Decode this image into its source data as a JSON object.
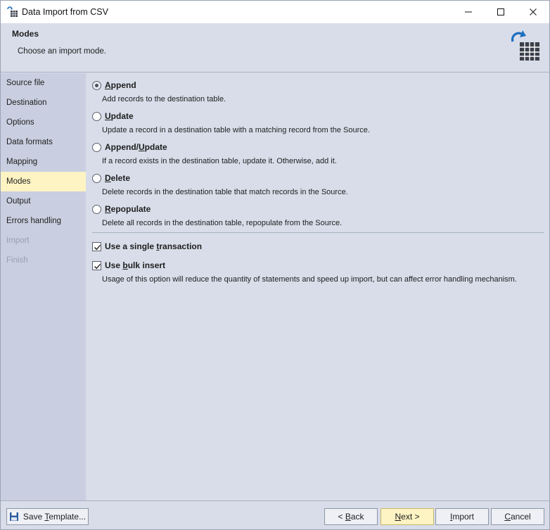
{
  "window": {
    "title": "Data Import from CSV",
    "minimize_icon": "minimize-icon",
    "maximize_icon": "maximize-icon",
    "close_icon": "close-icon"
  },
  "header": {
    "title": "Modes",
    "subtitle": "Choose an import mode."
  },
  "sidebar": {
    "items": [
      {
        "label": "Source file",
        "state": "normal"
      },
      {
        "label": "Destination",
        "state": "normal"
      },
      {
        "label": "Options",
        "state": "normal"
      },
      {
        "label": "Data formats",
        "state": "normal"
      },
      {
        "label": "Mapping",
        "state": "normal"
      },
      {
        "label": "Modes",
        "state": "active"
      },
      {
        "label": "Output",
        "state": "normal"
      },
      {
        "label": "Errors handling",
        "state": "normal"
      },
      {
        "label": "Import",
        "state": "disabled"
      },
      {
        "label": "Finish",
        "state": "disabled"
      }
    ]
  },
  "modes": {
    "selected": "Append",
    "options": [
      {
        "label_pre": "",
        "label_key": "A",
        "label_post": "ppend",
        "description": "Add records to the destination table."
      },
      {
        "label_pre": "",
        "label_key": "U",
        "label_post": "pdate",
        "description": "Update a record in a destination table with a matching record from the Source."
      },
      {
        "label_pre": "Append/",
        "label_key": "U",
        "label_post": "pdate",
        "description": "If a record exists in the destination table, update it. Otherwise, add it."
      },
      {
        "label_pre": "",
        "label_key": "D",
        "label_post": "elete",
        "description": "Delete records in the destination table that match records in the Source."
      },
      {
        "label_pre": "",
        "label_key": "R",
        "label_post": "epopulate",
        "description": "Delete all records in the destination table, repopulate from the Source."
      }
    ]
  },
  "checks": {
    "single_transaction": {
      "label_pre": "Use a single ",
      "label_key": "t",
      "label_post": "ransaction",
      "checked": true
    },
    "bulk_insert": {
      "label_pre": "Use ",
      "label_key": "b",
      "label_post": "ulk insert",
      "checked": true,
      "description": "Usage of this option will reduce the quantity of statements and speed up import, but can affect error handling mechanism."
    }
  },
  "footer": {
    "save_template": {
      "pre": "Save ",
      "key": "T",
      "post": "emplate..."
    },
    "back": {
      "pre": "< ",
      "key": "B",
      "post": "ack"
    },
    "next": {
      "pre": "",
      "key": "N",
      "post": "ext >"
    },
    "import": {
      "pre": "",
      "key": "I",
      "post": "mport"
    },
    "cancel": {
      "pre": "",
      "key": "C",
      "post": "ancel"
    }
  },
  "colors": {
    "accent_blue": "#1f6fbf",
    "active_item": "#fdf3c3",
    "sidebar_bg": "#c9cfe0",
    "content_bg": "#d8dde9"
  }
}
